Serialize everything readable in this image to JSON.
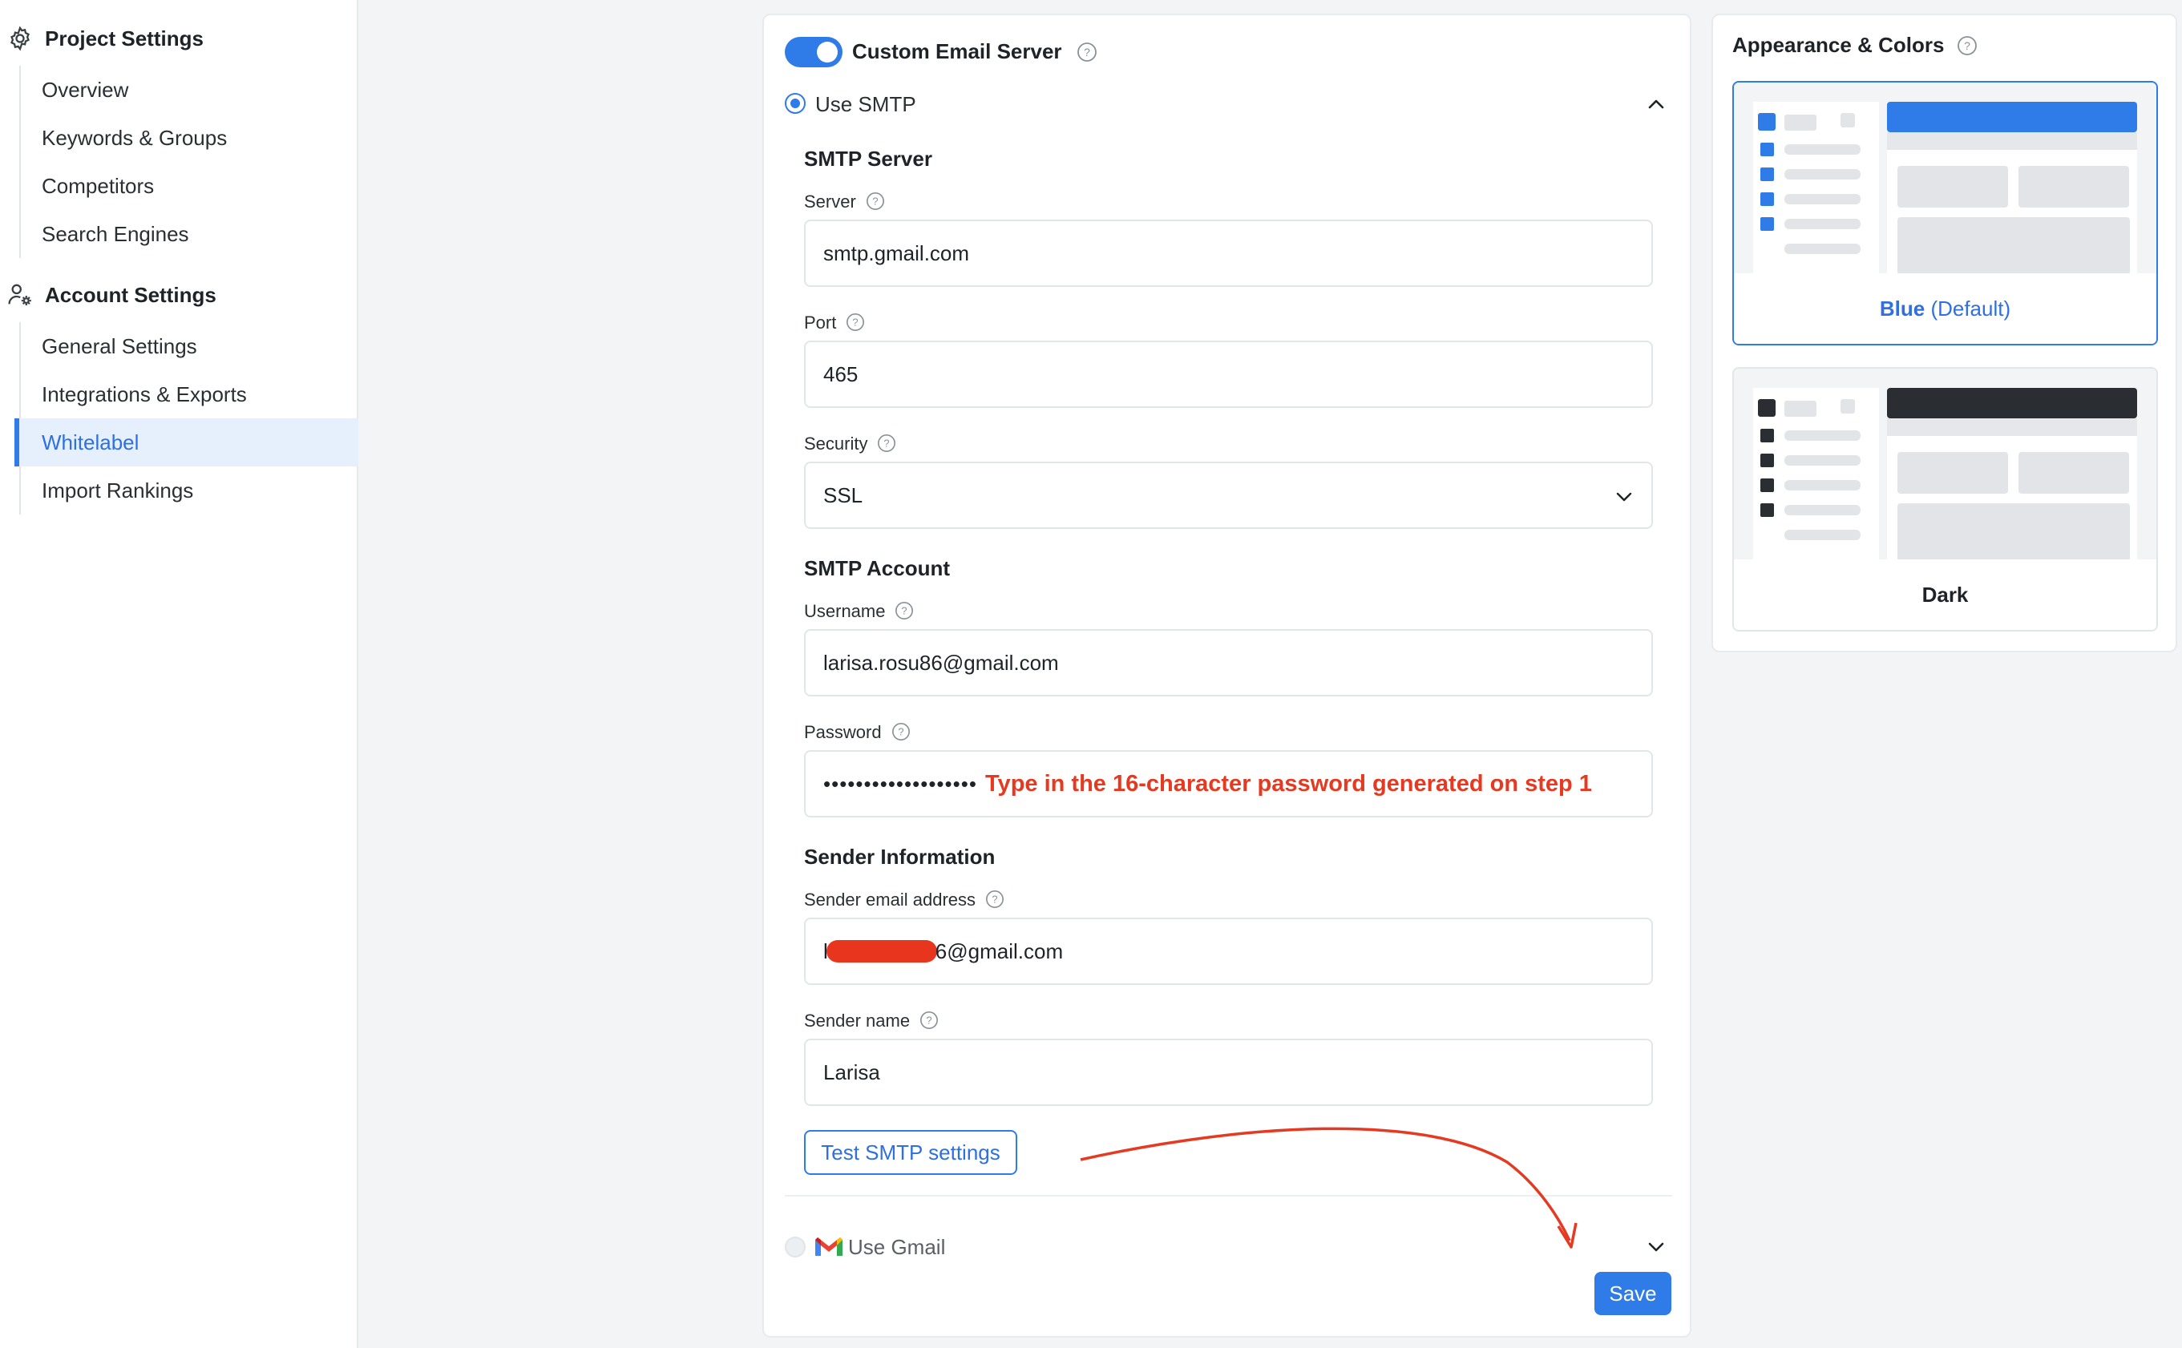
{
  "sidebar": {
    "project_settings": {
      "title": "Project Settings",
      "icon": "gear-icon",
      "items": [
        "Overview",
        "Keywords & Groups",
        "Competitors",
        "Search Engines"
      ]
    },
    "account_settings": {
      "title": "Account Settings",
      "icon": "user-gear-icon",
      "items": [
        "General Settings",
        "Integrations & Exports",
        "Whitelabel",
        "Import Rankings"
      ]
    },
    "active_item": "Whitelabel"
  },
  "email_server": {
    "toggle_on": true,
    "title": "Custom Email Server",
    "option_smtp": "Use SMTP",
    "smtp_server_heading": "SMTP Server",
    "server_label": "Server",
    "server_value": "smtp.gmail.com",
    "port_label": "Port",
    "port_value": "465",
    "security_label": "Security",
    "security_value": "SSL",
    "smtp_account_heading": "SMTP Account",
    "username_label": "Username",
    "username_value": "larisa.rosu86@gmail.com",
    "password_label": "Password",
    "password_value": "•••••••••••••••••••",
    "password_annotation": "Type in the 16-character password generated on step 1",
    "sender_info_heading": "Sender Information",
    "sender_email_label": "Sender email address",
    "sender_email_prefix": "l",
    "sender_email_suffix": "6@gmail.com",
    "sender_name_label": "Sender name",
    "sender_name_value": "Larisa",
    "test_button": "Test SMTP settings",
    "option_gmail": "Use Gmail",
    "save_button": "Save"
  },
  "appearance": {
    "title": "Appearance & Colors",
    "themes": [
      {
        "name": "Blue",
        "suffix": "(Default)",
        "selected": true,
        "accent": "#2f7be8"
      },
      {
        "name": "Dark",
        "suffix": "",
        "selected": false,
        "accent": "#2a2d31"
      }
    ]
  },
  "colors": {
    "accent": "#2f7be8",
    "annotation_red": "#e53a22",
    "active_bg": "#e6f0fd"
  }
}
